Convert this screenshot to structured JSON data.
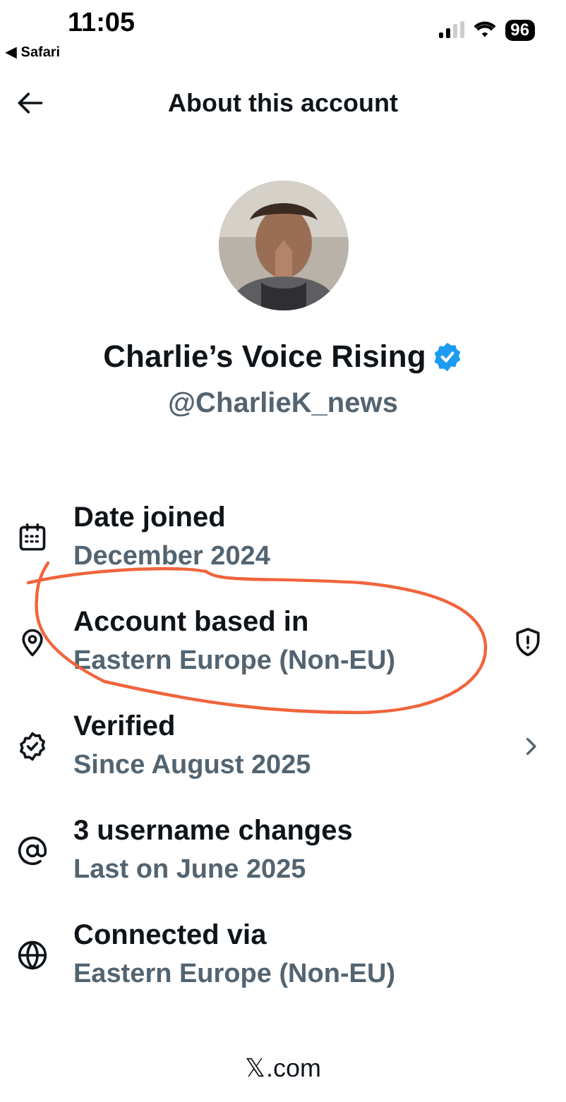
{
  "status_bar": {
    "time": "11:05",
    "back_glyph": "◀",
    "back_label": "Safari",
    "battery": "96"
  },
  "header": {
    "title": "About this account"
  },
  "profile": {
    "name": "Charlie’s Voice Rising",
    "verified": true,
    "handle": "@CharlieK_news"
  },
  "rows": [
    {
      "kind": "date",
      "title": "Date joined",
      "value": "December 2024",
      "warning": false,
      "opens": false,
      "circled": false
    },
    {
      "kind": "location",
      "title": "Account based in",
      "value": "Eastern Europe (Non-EU)",
      "warning": true,
      "opens": false,
      "circled": true
    },
    {
      "kind": "verified",
      "title": "Verified",
      "value": "Since August 2025",
      "warning": false,
      "opens": true,
      "circled": false
    },
    {
      "kind": "username",
      "title": "3 username changes",
      "value": "Last on June 2025",
      "warning": false,
      "opens": false,
      "circled": false
    },
    {
      "kind": "connection",
      "title": "Connected via",
      "value": "Eastern Europe (Non-EU)",
      "warning": false,
      "opens": false,
      "circled": false
    }
  ],
  "footer": {
    "site": "𝕏.com"
  }
}
